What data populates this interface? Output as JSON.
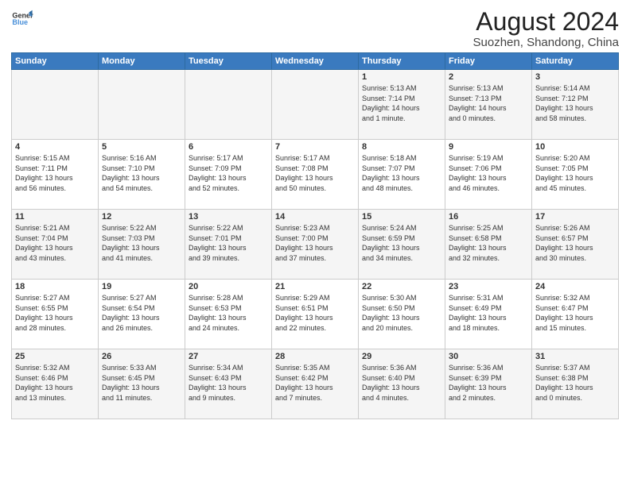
{
  "header": {
    "logo_line1": "General",
    "logo_line2": "Blue",
    "main_title": "August 2024",
    "subtitle": "Suozhen, Shandong, China"
  },
  "days_of_week": [
    "Sunday",
    "Monday",
    "Tuesday",
    "Wednesday",
    "Thursday",
    "Friday",
    "Saturday"
  ],
  "weeks": [
    [
      {
        "day": "",
        "content": ""
      },
      {
        "day": "",
        "content": ""
      },
      {
        "day": "",
        "content": ""
      },
      {
        "day": "",
        "content": ""
      },
      {
        "day": "1",
        "content": "Sunrise: 5:13 AM\nSunset: 7:14 PM\nDaylight: 14 hours\nand 1 minute."
      },
      {
        "day": "2",
        "content": "Sunrise: 5:13 AM\nSunset: 7:13 PM\nDaylight: 14 hours\nand 0 minutes."
      },
      {
        "day": "3",
        "content": "Sunrise: 5:14 AM\nSunset: 7:12 PM\nDaylight: 13 hours\nand 58 minutes."
      }
    ],
    [
      {
        "day": "4",
        "content": "Sunrise: 5:15 AM\nSunset: 7:11 PM\nDaylight: 13 hours\nand 56 minutes."
      },
      {
        "day": "5",
        "content": "Sunrise: 5:16 AM\nSunset: 7:10 PM\nDaylight: 13 hours\nand 54 minutes."
      },
      {
        "day": "6",
        "content": "Sunrise: 5:17 AM\nSunset: 7:09 PM\nDaylight: 13 hours\nand 52 minutes."
      },
      {
        "day": "7",
        "content": "Sunrise: 5:17 AM\nSunset: 7:08 PM\nDaylight: 13 hours\nand 50 minutes."
      },
      {
        "day": "8",
        "content": "Sunrise: 5:18 AM\nSunset: 7:07 PM\nDaylight: 13 hours\nand 48 minutes."
      },
      {
        "day": "9",
        "content": "Sunrise: 5:19 AM\nSunset: 7:06 PM\nDaylight: 13 hours\nand 46 minutes."
      },
      {
        "day": "10",
        "content": "Sunrise: 5:20 AM\nSunset: 7:05 PM\nDaylight: 13 hours\nand 45 minutes."
      }
    ],
    [
      {
        "day": "11",
        "content": "Sunrise: 5:21 AM\nSunset: 7:04 PM\nDaylight: 13 hours\nand 43 minutes."
      },
      {
        "day": "12",
        "content": "Sunrise: 5:22 AM\nSunset: 7:03 PM\nDaylight: 13 hours\nand 41 minutes."
      },
      {
        "day": "13",
        "content": "Sunrise: 5:22 AM\nSunset: 7:01 PM\nDaylight: 13 hours\nand 39 minutes."
      },
      {
        "day": "14",
        "content": "Sunrise: 5:23 AM\nSunset: 7:00 PM\nDaylight: 13 hours\nand 37 minutes."
      },
      {
        "day": "15",
        "content": "Sunrise: 5:24 AM\nSunset: 6:59 PM\nDaylight: 13 hours\nand 34 minutes."
      },
      {
        "day": "16",
        "content": "Sunrise: 5:25 AM\nSunset: 6:58 PM\nDaylight: 13 hours\nand 32 minutes."
      },
      {
        "day": "17",
        "content": "Sunrise: 5:26 AM\nSunset: 6:57 PM\nDaylight: 13 hours\nand 30 minutes."
      }
    ],
    [
      {
        "day": "18",
        "content": "Sunrise: 5:27 AM\nSunset: 6:55 PM\nDaylight: 13 hours\nand 28 minutes."
      },
      {
        "day": "19",
        "content": "Sunrise: 5:27 AM\nSunset: 6:54 PM\nDaylight: 13 hours\nand 26 minutes."
      },
      {
        "day": "20",
        "content": "Sunrise: 5:28 AM\nSunset: 6:53 PM\nDaylight: 13 hours\nand 24 minutes."
      },
      {
        "day": "21",
        "content": "Sunrise: 5:29 AM\nSunset: 6:51 PM\nDaylight: 13 hours\nand 22 minutes."
      },
      {
        "day": "22",
        "content": "Sunrise: 5:30 AM\nSunset: 6:50 PM\nDaylight: 13 hours\nand 20 minutes."
      },
      {
        "day": "23",
        "content": "Sunrise: 5:31 AM\nSunset: 6:49 PM\nDaylight: 13 hours\nand 18 minutes."
      },
      {
        "day": "24",
        "content": "Sunrise: 5:32 AM\nSunset: 6:47 PM\nDaylight: 13 hours\nand 15 minutes."
      }
    ],
    [
      {
        "day": "25",
        "content": "Sunrise: 5:32 AM\nSunset: 6:46 PM\nDaylight: 13 hours\nand 13 minutes."
      },
      {
        "day": "26",
        "content": "Sunrise: 5:33 AM\nSunset: 6:45 PM\nDaylight: 13 hours\nand 11 minutes."
      },
      {
        "day": "27",
        "content": "Sunrise: 5:34 AM\nSunset: 6:43 PM\nDaylight: 13 hours\nand 9 minutes."
      },
      {
        "day": "28",
        "content": "Sunrise: 5:35 AM\nSunset: 6:42 PM\nDaylight: 13 hours\nand 7 minutes."
      },
      {
        "day": "29",
        "content": "Sunrise: 5:36 AM\nSunset: 6:40 PM\nDaylight: 13 hours\nand 4 minutes."
      },
      {
        "day": "30",
        "content": "Sunrise: 5:36 AM\nSunset: 6:39 PM\nDaylight: 13 hours\nand 2 minutes."
      },
      {
        "day": "31",
        "content": "Sunrise: 5:37 AM\nSunset: 6:38 PM\nDaylight: 13 hours\nand 0 minutes."
      }
    ]
  ]
}
